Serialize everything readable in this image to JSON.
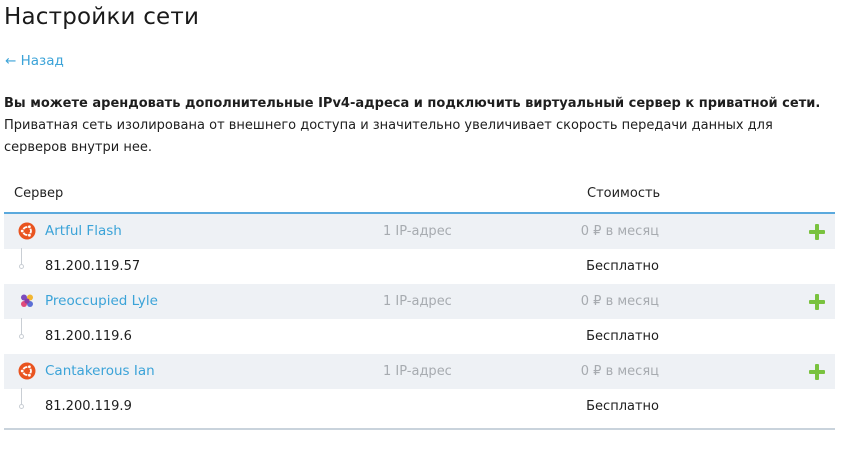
{
  "page": {
    "title": "Настройки сети",
    "back_label": "← Назад"
  },
  "intro": {
    "bold": "Вы можете арендовать дополнительные IPv4-адреса и подключить виртуальный сервер к приватной сети.",
    "text": "Приватная сеть изолирована от внешнего доступа и значительно увеличивает скорость передачи данных для серверов внутри нее."
  },
  "table": {
    "headers": {
      "server": "Сервер",
      "cost": "Стоимость"
    },
    "rows": [
      {
        "os_icon": "ubuntu-icon",
        "name": "Artful Flash",
        "ip_count": "1 IP-адрес",
        "price": "0 ₽ в месяц",
        "ip": "81.200.119.57",
        "ip_price": "Бесплатно"
      },
      {
        "os_icon": "multicolor-os-icon",
        "name": "Preoccupied Lyle",
        "ip_count": "1 IP-адрес",
        "price": "0 ₽ в месяц",
        "ip": "81.200.119.6",
        "ip_price": "Бесплатно"
      },
      {
        "os_icon": "ubuntu-icon",
        "name": "Cantakerous Ian",
        "ip_count": "1 IP-адрес",
        "price": "0 ₽ в месяц",
        "ip": "81.200.119.9",
        "ip_price": "Бесплатно"
      }
    ]
  },
  "colors": {
    "accent": "#3ba3d8",
    "add": "#79c23e",
    "ubuntu": "#e95420",
    "header_border": "#5aa9dd",
    "row_bg": "#eef1f5",
    "muted": "#a7abb0"
  }
}
